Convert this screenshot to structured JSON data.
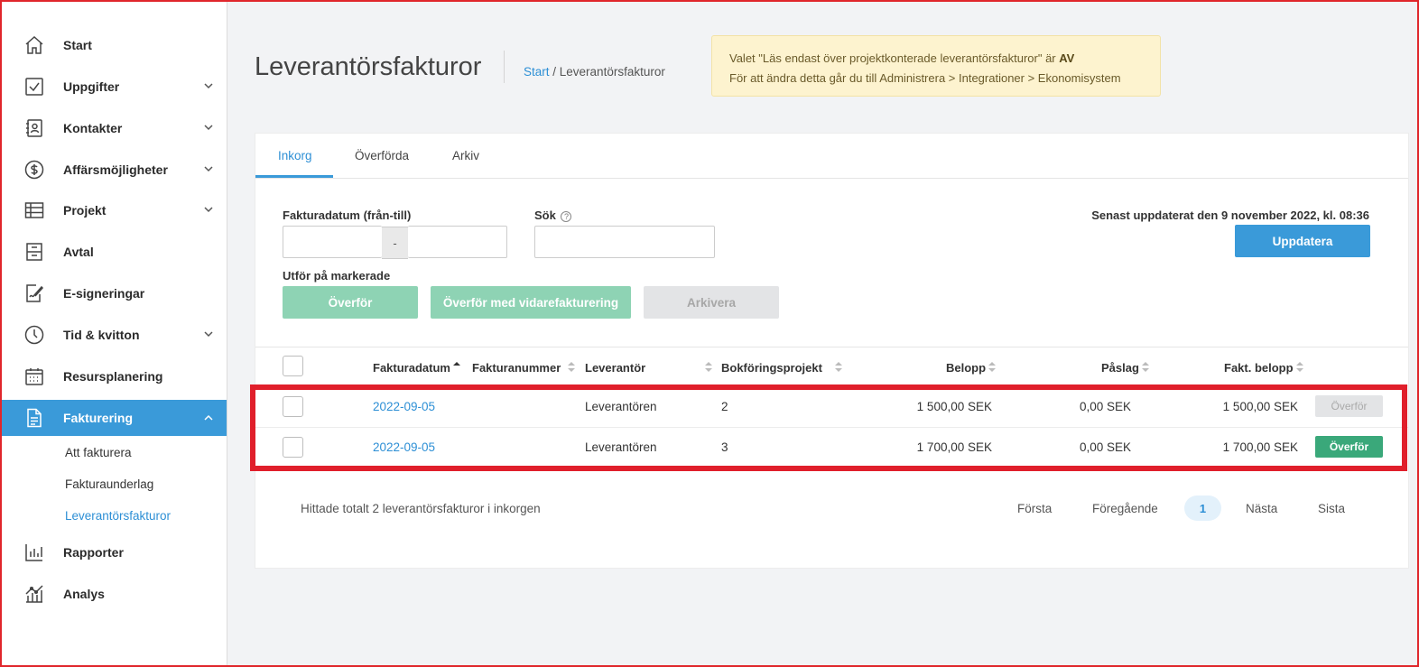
{
  "sidebar": {
    "items": [
      {
        "label": "Start",
        "icon": "home-icon"
      },
      {
        "label": "Uppgifter",
        "icon": "checkbox-icon"
      },
      {
        "label": "Kontakter",
        "icon": "contacts-icon"
      },
      {
        "label": "Affärsmöjligheter",
        "icon": "dollar-icon"
      },
      {
        "label": "Projekt",
        "icon": "table-icon"
      },
      {
        "label": "Avtal",
        "icon": "contract-icon"
      },
      {
        "label": "E-signeringar",
        "icon": "signature-icon"
      },
      {
        "label": "Tid & kvitton",
        "icon": "clock-icon"
      },
      {
        "label": "Resursplanering",
        "icon": "calendar-icon"
      },
      {
        "label": "Fakturering",
        "icon": "document-icon"
      },
      {
        "label": "Rapporter",
        "icon": "bar-chart-icon"
      },
      {
        "label": "Analys",
        "icon": "analytics-icon"
      }
    ],
    "subitems": [
      "Att fakturera",
      "Fakturaunderlag",
      "Leverantörsfakturor"
    ]
  },
  "header": {
    "title": "Leverantörsfakturor",
    "breadcrumb_link": "Start",
    "breadcrumb_sep": " / ",
    "breadcrumb_current": "Leverantörsfakturor"
  },
  "notice": {
    "line1_prefix": "Valet \"Läs endast över projektkonterade leverantörsfakturor\" är ",
    "line1_value": "AV",
    "line2": "För att ändra detta går du till Administrera > Integrationer > Ekonomisystem"
  },
  "tabs": [
    "Inkorg",
    "Överförda",
    "Arkiv"
  ],
  "filters": {
    "date_label": "Fakturadatum (från-till)",
    "date_sep": "-",
    "search_label": "Sök",
    "help_glyph": "?",
    "updated_text": "Senast uppdaterat den 9 november 2022, kl. 08:36",
    "update_button": "Uppdatera",
    "bulk_label": "Utför på markerade",
    "transfer_button": "Överför",
    "transfer_rebill_button": "Överför med vidarefakturering",
    "archive_button": "Arkivera"
  },
  "table": {
    "headers": [
      "Fakturadatum",
      "Fakturanummer",
      "Leverantör",
      "Bokföringsprojekt",
      "Belopp",
      "Påslag",
      "Fakt. belopp"
    ],
    "rows": [
      {
        "date": "2022-09-05",
        "number": "",
        "supplier": "Leverantören",
        "project": "2",
        "amount": "1 500,00 SEK",
        "markup": "0,00 SEK",
        "invoiced": "1 500,00 SEK",
        "action": "Överför",
        "enabled": false
      },
      {
        "date": "2022-09-05",
        "number": "",
        "supplier": "Leverantören",
        "project": "3",
        "amount": "1 700,00 SEK",
        "markup": "0,00 SEK",
        "invoiced": "1 700,00 SEK",
        "action": "Överför",
        "enabled": true
      }
    ]
  },
  "footer": {
    "summary": "Hittade totalt 2 leverantörsfakturor i inkorgen",
    "first": "Första",
    "prev": "Föregående",
    "page": "1",
    "next": "Nästa",
    "last": "Sista"
  },
  "colors": {
    "accent": "#3a9ad9",
    "success": "#3aa87a",
    "highlight": "#e01f2b",
    "notice_bg": "#fdf3cf"
  }
}
